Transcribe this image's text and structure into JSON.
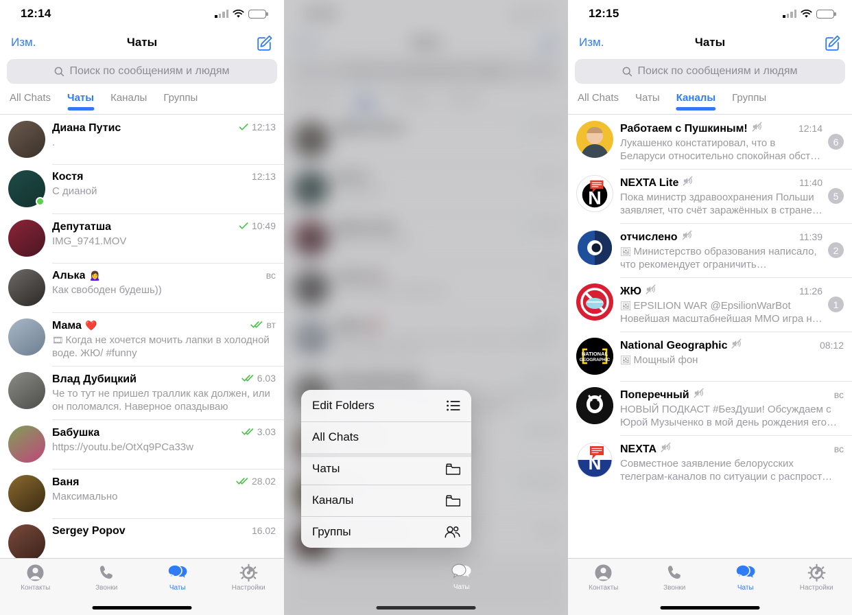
{
  "app": {
    "brand_blue": "#2f7cf6",
    "badge_gray": "#c4c4ca",
    "check_green": "#4fc24f"
  },
  "screens": {
    "left": {
      "status": {
        "time": "12:14"
      },
      "nav": {
        "left_label": "Изм.",
        "title": "Чаты",
        "compose_icon": "compose-icon"
      },
      "search": {
        "placeholder": "Поиск по сообщениям и людям",
        "icon": "search-icon"
      },
      "folder_tabs": [
        {
          "label": "All Chats",
          "active": false
        },
        {
          "label": "Чаты",
          "active": true
        },
        {
          "label": "Каналы",
          "active": false
        },
        {
          "label": "Группы",
          "active": false
        }
      ],
      "chats": [
        {
          "name": "Диана Путис",
          "emoji": "",
          "message": ".",
          "time": "12:13",
          "check": "single",
          "muted": false,
          "online": false,
          "badge": "",
          "avatar_colors": [
            "#6b5a4e",
            "#3a3129"
          ]
        },
        {
          "name": "Костя",
          "emoji": "",
          "message": "С дианой",
          "time": "12:13",
          "check": "none",
          "muted": false,
          "online": true,
          "badge": "",
          "avatar_colors": [
            "#1f4a46",
            "#123330"
          ]
        },
        {
          "name": "Депутатша",
          "emoji": "",
          "message": "IMG_9741.MOV",
          "time": "10:49",
          "check": "single",
          "muted": false,
          "online": false,
          "badge": "",
          "avatar_colors": [
            "#8c2438",
            "#4a1622"
          ]
        },
        {
          "name": "Алька",
          "emoji": "🙍‍♀️",
          "message": "Как свободен будешь))",
          "time": "вс",
          "check": "none",
          "muted": false,
          "online": false,
          "badge": "",
          "avatar_colors": [
            "#6e6a68",
            "#2b2826"
          ]
        },
        {
          "name": "Мама",
          "emoji": "❤️",
          "message": "Когда не хочется мочить лапки в холодной воде. ЖЮ/ #funny",
          "inline_icon": "🎞",
          "time": "вт",
          "check": "double",
          "muted": false,
          "online": false,
          "badge": "",
          "avatar_colors": [
            "#a9b7c6",
            "#6d7f92"
          ]
        },
        {
          "name": "Влад Дубицкий",
          "emoji": "",
          "message": "Че то тут не пришел траллик как должен, или он поломался. Наверное опаздываю",
          "time": "6.03",
          "check": "double",
          "muted": false,
          "online": false,
          "badge": "",
          "avatar_colors": [
            "#8b8b86",
            "#4c4c49"
          ]
        },
        {
          "name": "Бабушка",
          "emoji": "",
          "message": "https://youtu.be/OtXq9PCa33w",
          "time": "3.03",
          "check": "double",
          "muted": false,
          "online": false,
          "badge": "",
          "avatar_colors": [
            "#7fa05a",
            "#c0467a"
          ]
        },
        {
          "name": "Ваня",
          "emoji": "",
          "message": "Максимально",
          "time": "28.02",
          "check": "double",
          "muted": false,
          "online": false,
          "badge": "",
          "avatar_colors": [
            "#8a6a2f",
            "#3a2a12"
          ]
        },
        {
          "name": "Sergey Popov",
          "emoji": "",
          "message": "",
          "time": "16.02",
          "check": "none",
          "muted": false,
          "online": false,
          "badge": "",
          "avatar_colors": [
            "#7a4a3a",
            "#3a211a"
          ]
        }
      ],
      "tabbar": [
        {
          "label": "Контакты",
          "icon": "contacts-icon",
          "selected": false
        },
        {
          "label": "Звонки",
          "icon": "calls-icon",
          "selected": false
        },
        {
          "label": "Чаты",
          "icon": "chats-icon",
          "selected": true
        },
        {
          "label": "Настройки",
          "icon": "settings-icon",
          "selected": false
        }
      ]
    },
    "middle": {
      "status": {
        "time": "12:14"
      },
      "nav": {
        "left_label": "Изм.",
        "title": "Чаты",
        "compose_icon": "compose-icon"
      },
      "search": {
        "placeholder": "Поиск по сообщениям и людям",
        "icon": "search-icon"
      },
      "folder_tabs": [
        {
          "label": "All Chats",
          "active": false
        },
        {
          "label": "Чаты",
          "active": true
        },
        {
          "label": "Каналы",
          "active": false
        },
        {
          "label": "Группы",
          "active": false
        }
      ],
      "context_menu": [
        {
          "label": "Edit Folders",
          "icon": "list-icon"
        },
        {
          "label": "All Chats",
          "icon": ""
        },
        {
          "label": "Чаты",
          "icon": "folder-icon"
        },
        {
          "label": "Каналы",
          "icon": "folder-icon"
        },
        {
          "label": "Группы",
          "icon": "people-icon"
        }
      ],
      "tabbar_visible_label": "Чаты"
    },
    "right": {
      "status": {
        "time": "12:15"
      },
      "nav": {
        "left_label": "Изм.",
        "title": "Чаты",
        "compose_icon": "compose-icon"
      },
      "search": {
        "placeholder": "Поиск по сообщениям и людям",
        "icon": "search-icon"
      },
      "folder_tabs": [
        {
          "label": "All Chats",
          "active": false
        },
        {
          "label": "Чаты",
          "active": false
        },
        {
          "label": "Каналы",
          "active": true
        },
        {
          "label": "Группы",
          "active": false
        }
      ],
      "chats": [
        {
          "name": "Работаем с Пушкиным!",
          "message": "Лукашенко констатировал, что в Беларуси относительно спокойная обст…",
          "time": "12:14",
          "muted": true,
          "badge": "6",
          "avatar": "pushkin"
        },
        {
          "name": "NEXTA Lite",
          "message": "Пока министр здравоохранения Польши заявляет, что счёт заражённых в стране…",
          "time": "11:40",
          "muted": true,
          "badge": "5",
          "avatar": "nexta-lite"
        },
        {
          "name": "отчислено",
          "message": "Министерство образования написало, что рекомендует  ограничить…",
          "inline_icon": "🖼",
          "time": "11:39",
          "muted": true,
          "badge": "2",
          "avatar": "otchisleno"
        },
        {
          "name": "ЖЮ",
          "message": "EPSILION WAR @EpsilionWarBot Новейшая масштабнейшая ММО игра н…",
          "inline_icon": "🖼",
          "time": "11:26",
          "muted": true,
          "badge": "1",
          "avatar": "zhyu"
        },
        {
          "name": "National Geographic",
          "message": "Мощный фон",
          "inline_icon": "🖼",
          "time": "08:12",
          "muted": true,
          "badge": "",
          "avatar": "natgeo"
        },
        {
          "name": "Поперечный",
          "message": "НОВЫЙ ПОДКАСТ #БезДуши! Обсуждаем с Юрой Музыченко в мой день рождения его…",
          "time": "вс",
          "muted": true,
          "badge": "",
          "avatar": "poperechny"
        },
        {
          "name": "NEXTA",
          "message": "Совместное заявление белорусских телеграм-каналов по ситуации с распрост…",
          "time": "вс",
          "muted": true,
          "badge": "",
          "avatar": "nexta"
        }
      ],
      "tabbar": [
        {
          "label": "Контакты",
          "icon": "contacts-icon",
          "selected": false
        },
        {
          "label": "Звонки",
          "icon": "calls-icon",
          "selected": false
        },
        {
          "label": "Чаты",
          "icon": "chats-icon",
          "selected": true
        },
        {
          "label": "Настройки",
          "icon": "settings-icon",
          "selected": false
        }
      ]
    }
  }
}
